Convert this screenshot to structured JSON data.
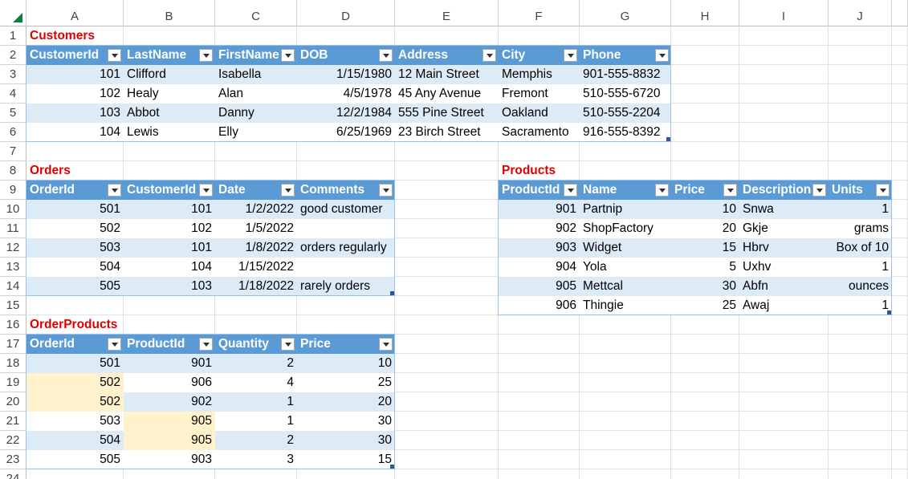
{
  "columns": [
    "A",
    "B",
    "C",
    "D",
    "E",
    "F",
    "G",
    "H",
    "I",
    "J"
  ],
  "rows": [
    "1",
    "2",
    "3",
    "4",
    "5",
    "6",
    "7",
    "8",
    "9",
    "10",
    "11",
    "12",
    "13",
    "14",
    "15",
    "16",
    "17",
    "18",
    "19",
    "20",
    "21",
    "22",
    "23",
    "24"
  ],
  "customers": {
    "title": "Customers",
    "headers": [
      "CustomerId",
      "LastName",
      "FirstName",
      "DOB",
      "Address",
      "City",
      "Phone"
    ],
    "rows": [
      [
        "101",
        "Clifford",
        "Isabella",
        "1/15/1980",
        "12 Main Street",
        "Memphis",
        "901-555-8832"
      ],
      [
        "102",
        "Healy",
        "Alan",
        "4/5/1978",
        "45 Any Avenue",
        "Fremont",
        "510-555-6720"
      ],
      [
        "103",
        "Abbot",
        "Danny",
        "12/2/1984",
        "555 Pine Street",
        "Oakland",
        "510-555-2204"
      ],
      [
        "104",
        "Lewis",
        "Elly",
        "6/25/1969",
        "23 Birch Street",
        "Sacramento",
        "916-555-8392"
      ]
    ]
  },
  "orders": {
    "title": "Orders",
    "headers": [
      "OrderId",
      "CustomerId",
      "Date",
      "Comments"
    ],
    "rows": [
      [
        "501",
        "101",
        "1/2/2022",
        "good customer"
      ],
      [
        "502",
        "102",
        "1/5/2022",
        ""
      ],
      [
        "503",
        "101",
        "1/8/2022",
        "orders regularly"
      ],
      [
        "504",
        "104",
        "1/15/2022",
        ""
      ],
      [
        "505",
        "103",
        "1/18/2022",
        "rarely orders"
      ]
    ]
  },
  "products": {
    "title": "Products",
    "headers": [
      "ProductId",
      "Name",
      "Price",
      "Description",
      "Units"
    ],
    "rows": [
      [
        "901",
        "Partnip",
        "10",
        "Snwa",
        "1"
      ],
      [
        "902",
        "ShopFactory",
        "20",
        "Gkje",
        "grams"
      ],
      [
        "903",
        "Widget",
        "15",
        "Hbrv",
        "Box of 10"
      ],
      [
        "904",
        "Yola",
        "5",
        "Uxhv",
        "1"
      ],
      [
        "905",
        "Mettcal",
        "30",
        "Abfn",
        "ounces"
      ],
      [
        "906",
        "Thingie",
        "25",
        "Awaj",
        "1"
      ]
    ]
  },
  "order_products": {
    "title": "OrderProducts",
    "headers": [
      "OrderId",
      "ProductId",
      "Quantity",
      "Price"
    ],
    "rows": [
      [
        "501",
        "901",
        "2",
        "10"
      ],
      [
        "502",
        "906",
        "4",
        "25"
      ],
      [
        "502",
        "902",
        "1",
        "20"
      ],
      [
        "503",
        "905",
        "1",
        "30"
      ],
      [
        "504",
        "905",
        "2",
        "30"
      ],
      [
        "505",
        "903",
        "3",
        "15"
      ]
    ]
  },
  "colors": {
    "title_red": "#e00000",
    "header_blue": "#5b9bd5",
    "band_blue": "#ddebf7",
    "highlight_yellow": "#fff2cc"
  }
}
